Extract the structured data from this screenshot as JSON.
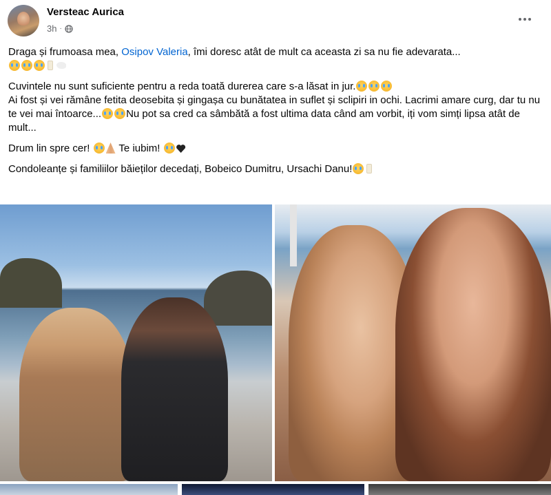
{
  "post": {
    "author": "Versteac Aurica",
    "time": "3h",
    "separator": "·",
    "privacy_icon": "globe-icon",
    "menu_icon": "more-options-icon"
  },
  "body": {
    "p1_text": "Draga și frumoasa mea, ",
    "p1_mention": "Osipov Valeria",
    "p1_rest": ", îmi doresc atât de mult ca aceasta zi sa nu fie adevarata...",
    "p2_line1": "Cuvintele nu sunt suficiente pentru a reda toată durerea care s-a lăsat in jur.",
    "p2_line2": "Ai fost și vei rămâne fetita deosebita și gingașa cu bunătatea in suflet și sclipiri in ochi. Lacrimi amare curg, dar tu nu te vei mai întoarce...",
    "p2_line2_end": "Nu pot sa cred ca sâmbătă a fost ultima data când am vorbit, iți vom simți lipsa atât de mult...",
    "p3_a": "Drum lin spre cer! ",
    "p3_b": " Te iubim! ",
    "p4": "Condoleanțe și familiilor băieților decedați, Bobeico Dumitru, Ursachi Danu!"
  },
  "colors": {
    "text": "#050505",
    "secondary": "#65676b",
    "link": "#0064d1"
  }
}
